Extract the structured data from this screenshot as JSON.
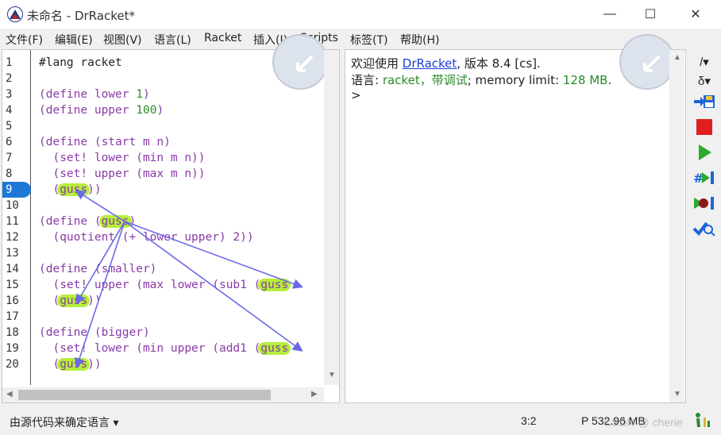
{
  "window": {
    "title": "未命名 - DrRacket*",
    "minimize": "—",
    "maximize": "☐",
    "close": "✕"
  },
  "menu": [
    {
      "label": "文件(F)"
    },
    {
      "label": "编辑(E)"
    },
    {
      "label": "视图(V)"
    },
    {
      "label": "语言(L)"
    },
    {
      "label": "Racket"
    },
    {
      "label": "插入(I)"
    },
    {
      "label": "Scripts"
    },
    {
      "label": "标签(T)"
    },
    {
      "label": "帮助(H)"
    }
  ],
  "editor": {
    "line_numbers": [
      "1",
      "2",
      "3",
      "4",
      "5",
      "6",
      "7",
      "8",
      "9",
      "10",
      "11",
      "12",
      "13",
      "14",
      "15",
      "16",
      "17",
      "18",
      "19",
      "20"
    ],
    "active_line": "9",
    "lines": {
      "l1": "#lang racket",
      "l3a": "(define ",
      "l3b": "lower",
      "l3c": " ",
      "l3d": "1",
      "l3e": ")",
      "l4a": "(define ",
      "l4b": "upper",
      "l4c": " ",
      "l4d": "100",
      "l4e": ")",
      "l6": "(define (start m n)",
      "l7": "  (set! lower (min m n))",
      "l8": "  (set! upper (max m n))",
      "l9a": "  (",
      "l9b": "guss",
      "l9c": "))",
      "l11a": "(define (",
      "l11b": "guss",
      "l11c": ")",
      "l12": "  (quotient (+ lower upper) 2))",
      "l14": "(define (smaller)",
      "l15a": "  (set! upper (max lower (sub1 (",
      "l15b": "guss",
      "l16a": "  (",
      "l16b": "guss",
      "l16c": "))",
      "l18": "(define (bigger)",
      "l19a": "  (set! lower (min upper (add1 (",
      "l19b": "guss",
      "l20a": "  (",
      "l20b": "guss",
      "l20c": "))"
    }
  },
  "repl": {
    "welcome_prefix": "欢迎使用 ",
    "welcome_link": "DrRacket",
    "welcome_suffix": ", 版本 8.4 [cs].",
    "lang_prefix": "语言: ",
    "lang_value": "racket，带调试",
    "lang_mid": "; memory limit: ",
    "lang_limit": "128 MB",
    "lang_end": ".",
    "prompt": ">"
  },
  "toolbar": {
    "check_syntax": "/▾",
    "macro_stepper": "δ▾",
    "save": "save-icon",
    "stop": "stop-icon",
    "run": "run-icon",
    "step": "step-icon",
    "debug": "debug-icon",
    "check": "check-syntax-icon"
  },
  "status": {
    "language": "由源代码来确定语言 ▾",
    "position": "3:2",
    "memory": "P   532.96 MB",
    "watermark": "CSDN @ cherie"
  },
  "colors": {
    "highlight": "#b6ee3a",
    "arrow": "#6a6ae8",
    "active_line": "#1e78d6",
    "stop": "#e01f1f",
    "run": "#2eaa2e"
  }
}
